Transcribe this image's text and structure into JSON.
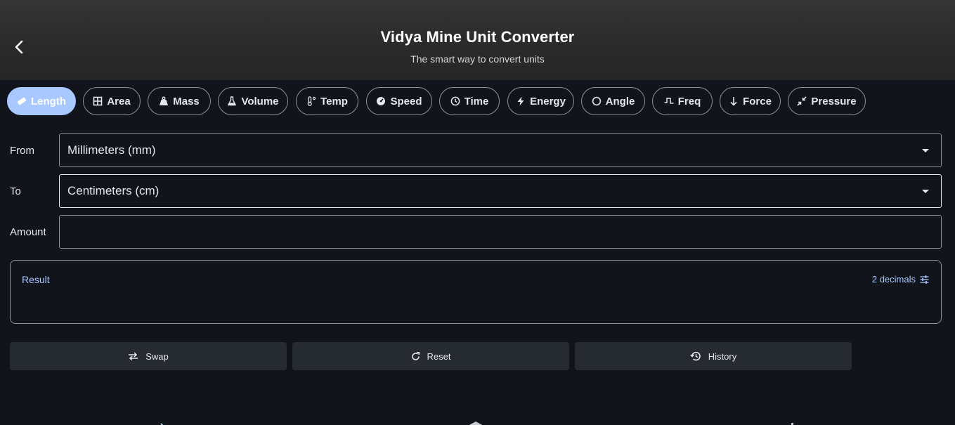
{
  "header": {
    "title": "Vidya Mine Unit Converter",
    "subtitle": "The smart way to convert units",
    "back_icon": "chevron-left-icon"
  },
  "categories": [
    {
      "label": "Length",
      "icon": "ruler-icon",
      "active": true
    },
    {
      "label": "Area",
      "icon": "grid-icon",
      "active": false
    },
    {
      "label": "Mass",
      "icon": "weight-icon",
      "active": false
    },
    {
      "label": "Volume",
      "icon": "flask-icon",
      "active": false
    },
    {
      "label": "Temp",
      "icon": "thermometer-icon",
      "active": false
    },
    {
      "label": "Speed",
      "icon": "speedometer-icon",
      "active": false
    },
    {
      "label": "Time",
      "icon": "clock-icon",
      "active": false
    },
    {
      "label": "Energy",
      "icon": "bolt-icon",
      "active": false
    },
    {
      "label": "Angle",
      "icon": "circle-icon",
      "active": false
    },
    {
      "label": "Freq",
      "icon": "wave-icon",
      "active": false
    },
    {
      "label": "Force",
      "icon": "arrow-down-icon",
      "active": false
    },
    {
      "label": "Pressure",
      "icon": "compress-icon",
      "active": false
    }
  ],
  "form": {
    "from_label": "From",
    "from_value": "Millimeters (mm)",
    "to_label": "To",
    "to_value": "Centimeters (cm)",
    "amount_label": "Amount",
    "amount_value": ""
  },
  "result": {
    "label": "Result",
    "value": "",
    "decimals_label": "2 decimals"
  },
  "actions": {
    "swap_label": "Swap",
    "reset_label": "Reset",
    "history_label": "History"
  },
  "colors": {
    "accent": "#a8c8ff",
    "background": "#11141a",
    "header": "#2e2e2e",
    "button": "#262a31"
  }
}
